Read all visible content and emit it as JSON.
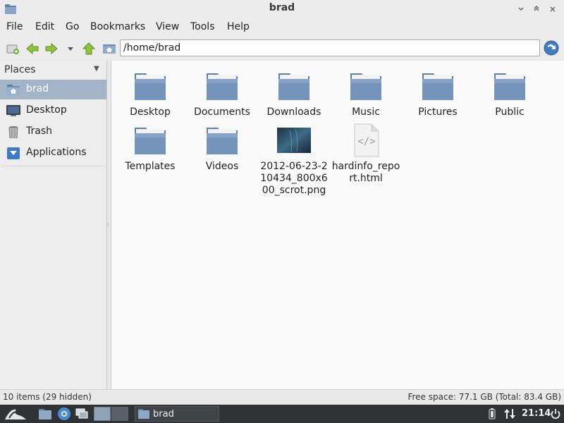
{
  "window": {
    "title": "brad"
  },
  "menubar": {
    "items": [
      "File",
      "Edit",
      "Go",
      "Bookmarks",
      "View",
      "Tools",
      "Help"
    ]
  },
  "toolbar": {
    "path": "/home/brad",
    "icons": [
      "new-tab-icon",
      "back-icon",
      "forward-icon",
      "history-dropdown-icon",
      "parent-folder-icon",
      "home-icon",
      "go-icon"
    ]
  },
  "sidepane": {
    "header": "Places",
    "items": [
      {
        "label": "brad",
        "icon": "home-folder-icon",
        "selected": true
      },
      {
        "label": "Desktop",
        "icon": "desktop-icon",
        "selected": false
      },
      {
        "label": "Trash",
        "icon": "trash-icon",
        "selected": false
      },
      {
        "label": "Applications",
        "icon": "applications-icon",
        "selected": false
      }
    ]
  },
  "files": [
    {
      "name": "Desktop",
      "type": "folder"
    },
    {
      "name": "Documents",
      "type": "folder"
    },
    {
      "name": "Downloads",
      "type": "folder"
    },
    {
      "name": "Music",
      "type": "folder"
    },
    {
      "name": "Pictures",
      "type": "folder"
    },
    {
      "name": "Public",
      "type": "folder"
    },
    {
      "name": "Templates",
      "type": "folder"
    },
    {
      "name": "Videos",
      "type": "folder"
    },
    {
      "name": "2012-06-23-210434_800x600_scrot.png",
      "type": "image"
    },
    {
      "name": "hardinfo_report.html",
      "type": "html"
    }
  ],
  "statusbar": {
    "items_text": "10 items (29 hidden)",
    "space_text": "Free space: 77.1 GB (Total: 83.4 GB)"
  },
  "taskbar": {
    "task_label": "brad",
    "clock": "21:14"
  },
  "colors": {
    "selection": "#a3b4c8",
    "folder_blue": "#6f8fb5",
    "taskbar_bg": "#2f3336"
  }
}
